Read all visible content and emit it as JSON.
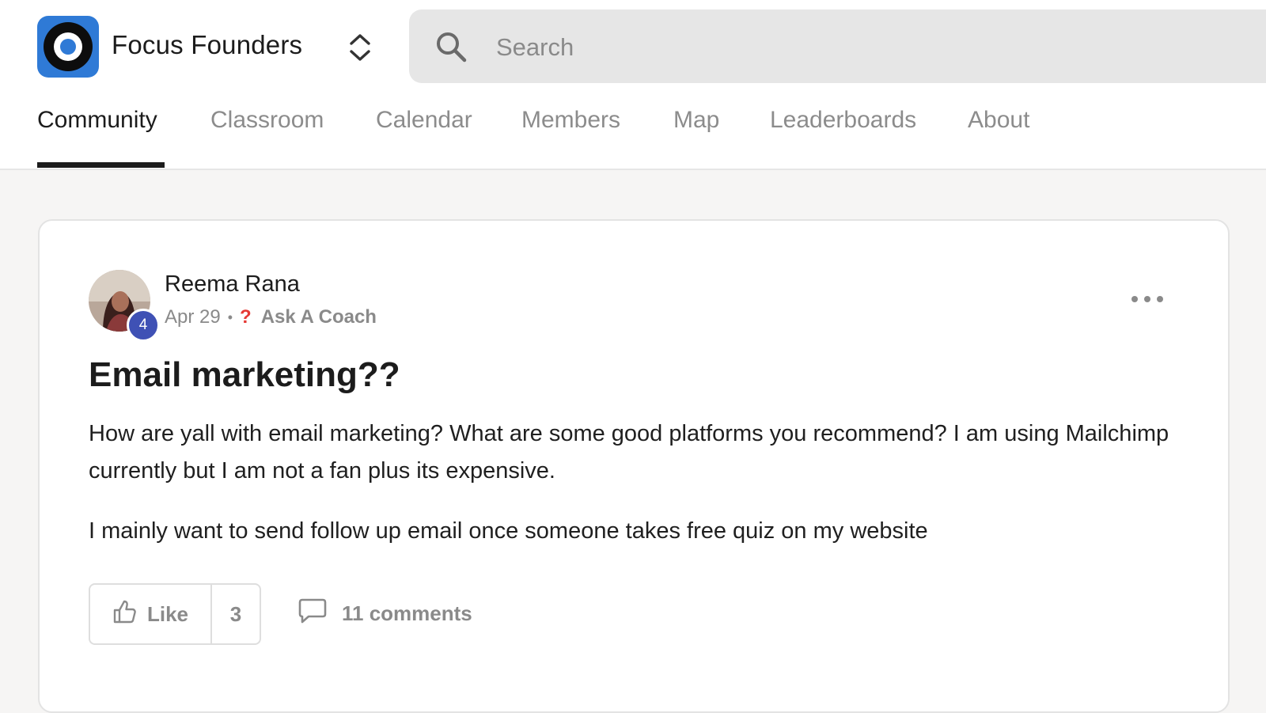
{
  "header": {
    "group_name": "Focus Founders",
    "logo_icon": "target-logo-icon",
    "switcher_icon": "chevron-up-down-icon",
    "search": {
      "icon": "search-icon",
      "placeholder": "Search",
      "value": ""
    }
  },
  "nav": {
    "active": "Community",
    "tabs": [
      {
        "label": "Community"
      },
      {
        "label": "Classroom"
      },
      {
        "label": "Calendar"
      },
      {
        "label": "Members"
      },
      {
        "label": "Map"
      },
      {
        "label": "Leaderboards"
      },
      {
        "label": "About"
      }
    ]
  },
  "post": {
    "author": "Reema Rana",
    "level": "4",
    "date": "Apr 29",
    "separator": "•",
    "category_icon": "question-mark-icon",
    "category_glyph": "?",
    "category": "Ask A Coach",
    "title": "Email marketing??",
    "body": [
      "How are yall with email marketing? What are some good platforms you recommend? I am using Mailchimp currently but I am not a fan plus its expensive.",
      "I mainly want to send follow up email once someone takes free quiz on my website"
    ],
    "like_label": "Like",
    "like_count": "3",
    "comments_label": "11 comments"
  },
  "colors": {
    "accent": "#2f7ad6",
    "level_badge": "#3f51b5",
    "category_icon": "#e53935",
    "muted_text": "#8a8a8a",
    "page_bg": "#f6f5f4"
  }
}
